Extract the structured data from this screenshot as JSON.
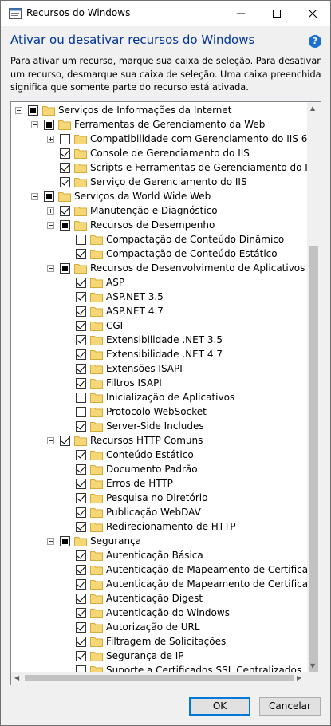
{
  "window": {
    "title": "Recursos do Windows"
  },
  "heading": "Ativar ou desativar recursos do Windows",
  "description": "Para ativar um recurso, marque sua caixa de seleção. Para desativar um recurso, desmarque sua caixa de seleção. Uma caixa preenchida significa que somente parte do recurso está ativada.",
  "tree": [
    {
      "level": 0,
      "expander": "minus",
      "state": "partial",
      "label": "Serviços de Informações da Internet"
    },
    {
      "level": 1,
      "expander": "minus",
      "state": "partial",
      "label": "Ferramentas de Gerenciamento da Web"
    },
    {
      "level": 2,
      "expander": "plus",
      "state": "unchecked",
      "label": "Compatibilidade com Gerenciamento do IIS 6"
    },
    {
      "level": 2,
      "expander": "none",
      "state": "checked",
      "label": "Console de Gerenciamento do IIS"
    },
    {
      "level": 2,
      "expander": "none",
      "state": "checked",
      "label": "Scripts e Ferramentas de Gerenciamento do IIS"
    },
    {
      "level": 2,
      "expander": "none",
      "state": "checked",
      "label": "Serviço de Gerenciamento do IIS"
    },
    {
      "level": 1,
      "expander": "minus",
      "state": "partial",
      "label": "Serviços da World Wide Web"
    },
    {
      "level": 2,
      "expander": "plus",
      "state": "checked",
      "label": "Manutenção e Diagnóstico"
    },
    {
      "level": 2,
      "expander": "minus",
      "state": "partial",
      "label": "Recursos de Desempenho"
    },
    {
      "level": 3,
      "expander": "none",
      "state": "unchecked",
      "label": "Compactação de Conteúdo Dinâmico"
    },
    {
      "level": 3,
      "expander": "none",
      "state": "checked",
      "label": "Compactação de Conteúdo Estático"
    },
    {
      "level": 2,
      "expander": "minus",
      "state": "partial",
      "label": "Recursos de Desenvolvimento de Aplicativos"
    },
    {
      "level": 3,
      "expander": "none",
      "state": "checked",
      "label": "ASP"
    },
    {
      "level": 3,
      "expander": "none",
      "state": "checked",
      "label": "ASP.NET 3.5"
    },
    {
      "level": 3,
      "expander": "none",
      "state": "checked",
      "label": "ASP.NET 4.7"
    },
    {
      "level": 3,
      "expander": "none",
      "state": "checked",
      "label": "CGI"
    },
    {
      "level": 3,
      "expander": "none",
      "state": "checked",
      "label": "Extensibilidade .NET 3.5"
    },
    {
      "level": 3,
      "expander": "none",
      "state": "checked",
      "label": "Extensibilidade .NET 4.7"
    },
    {
      "level": 3,
      "expander": "none",
      "state": "checked",
      "label": "Extensões ISAPI"
    },
    {
      "level": 3,
      "expander": "none",
      "state": "checked",
      "label": "Filtros ISAPI"
    },
    {
      "level": 3,
      "expander": "none",
      "state": "unchecked",
      "label": "Inicialização de Aplicativos"
    },
    {
      "level": 3,
      "expander": "none",
      "state": "unchecked",
      "label": "Protocolo WebSocket"
    },
    {
      "level": 3,
      "expander": "none",
      "state": "checked",
      "label": "Server-Side Includes"
    },
    {
      "level": 2,
      "expander": "minus",
      "state": "checked",
      "label": "Recursos HTTP Comuns"
    },
    {
      "level": 3,
      "expander": "none",
      "state": "checked",
      "label": "Conteúdo Estático"
    },
    {
      "level": 3,
      "expander": "none",
      "state": "checked",
      "label": "Documento Padrão"
    },
    {
      "level": 3,
      "expander": "none",
      "state": "checked",
      "label": "Erros de HTTP"
    },
    {
      "level": 3,
      "expander": "none",
      "state": "checked",
      "label": "Pesquisa no Diretório"
    },
    {
      "level": 3,
      "expander": "none",
      "state": "checked",
      "label": "Publicação WebDAV"
    },
    {
      "level": 3,
      "expander": "none",
      "state": "checked",
      "label": "Redirecionamento de HTTP"
    },
    {
      "level": 2,
      "expander": "minus",
      "state": "partial",
      "label": "Segurança"
    },
    {
      "level": 3,
      "expander": "none",
      "state": "checked",
      "label": "Autenticação Básica"
    },
    {
      "level": 3,
      "expander": "none",
      "state": "checked",
      "label": "Autenticação de Mapeamento de Certificado de Cliente"
    },
    {
      "level": 3,
      "expander": "none",
      "state": "checked",
      "label": "Autenticação de Mapeamento de Certificado de Cliente do IIS"
    },
    {
      "level": 3,
      "expander": "none",
      "state": "checked",
      "label": "Autenticação Digest"
    },
    {
      "level": 3,
      "expander": "none",
      "state": "checked",
      "label": "Autenticação do Windows"
    },
    {
      "level": 3,
      "expander": "none",
      "state": "checked",
      "label": "Autorização de URL"
    },
    {
      "level": 3,
      "expander": "none",
      "state": "checked",
      "label": "Filtragem de Solicitações"
    },
    {
      "level": 3,
      "expander": "none",
      "state": "checked",
      "label": "Segurança de IP"
    },
    {
      "level": 3,
      "expander": "none",
      "state": "unchecked",
      "label": "Suporte a Certificados SSL Centralizados"
    }
  ],
  "buttons": {
    "ok": "OK",
    "cancel": "Cancelar"
  },
  "colors": {
    "heading": "#003399",
    "accent": "#0078d7",
    "folder": "#f6d778"
  }
}
